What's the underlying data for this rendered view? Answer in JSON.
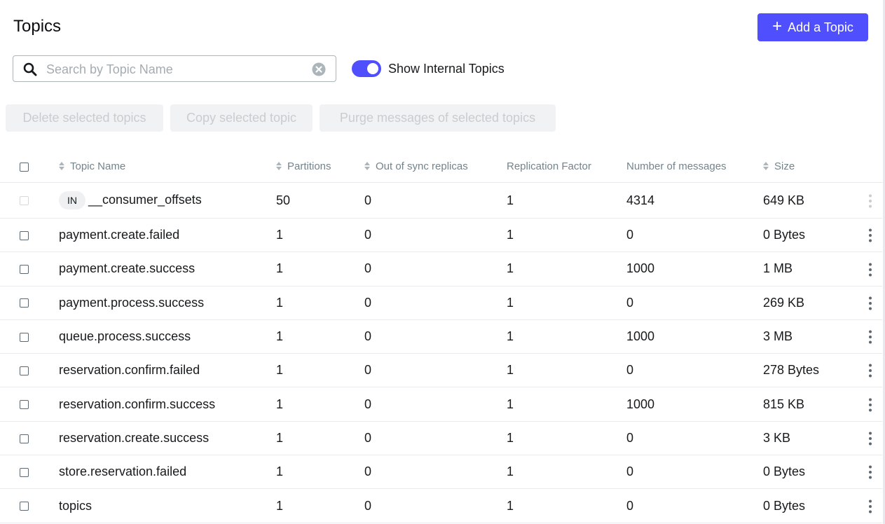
{
  "header": {
    "title": "Topics",
    "add_button_label": "Add a Topic"
  },
  "search": {
    "placeholder": "Search by Topic Name",
    "value": ""
  },
  "toggle": {
    "label": "Show Internal Topics",
    "checked": true
  },
  "actions": {
    "delete_label": "Delete selected topics",
    "copy_label": "Copy selected topic",
    "purge_label": "Purge messages of selected topics"
  },
  "table": {
    "columns": {
      "topic_name": "Topic Name",
      "partitions": "Partitions",
      "out_of_sync": "Out of sync replicas",
      "replication_factor": "Replication Factor",
      "messages": "Number of messages",
      "size": "Size"
    },
    "rows": [
      {
        "badge": "IN",
        "name": "__consumer_offsets",
        "partitions": "50",
        "out_of_sync": "0",
        "replication_factor": "1",
        "messages": "4314",
        "size": "649 KB"
      },
      {
        "badge": "",
        "name": "payment.create.failed",
        "partitions": "1",
        "out_of_sync": "0",
        "replication_factor": "1",
        "messages": "0",
        "size": "0 Bytes"
      },
      {
        "badge": "",
        "name": "payment.create.success",
        "partitions": "1",
        "out_of_sync": "0",
        "replication_factor": "1",
        "messages": "1000",
        "size": "1 MB"
      },
      {
        "badge": "",
        "name": "payment.process.success",
        "partitions": "1",
        "out_of_sync": "0",
        "replication_factor": "1",
        "messages": "0",
        "size": "269 KB"
      },
      {
        "badge": "",
        "name": "queue.process.success",
        "partitions": "1",
        "out_of_sync": "0",
        "replication_factor": "1",
        "messages": "1000",
        "size": "3 MB"
      },
      {
        "badge": "",
        "name": "reservation.confirm.failed",
        "partitions": "1",
        "out_of_sync": "0",
        "replication_factor": "1",
        "messages": "0",
        "size": "278 Bytes"
      },
      {
        "badge": "",
        "name": "reservation.confirm.success",
        "partitions": "1",
        "out_of_sync": "0",
        "replication_factor": "1",
        "messages": "1000",
        "size": "815 KB"
      },
      {
        "badge": "",
        "name": "reservation.create.success",
        "partitions": "1",
        "out_of_sync": "0",
        "replication_factor": "1",
        "messages": "0",
        "size": "3 KB"
      },
      {
        "badge": "",
        "name": "store.reservation.failed",
        "partitions": "1",
        "out_of_sync": "0",
        "replication_factor": "1",
        "messages": "0",
        "size": "0 Bytes"
      },
      {
        "badge": "",
        "name": "topics",
        "partitions": "1",
        "out_of_sync": "0",
        "replication_factor": "1",
        "messages": "0",
        "size": "0 Bytes"
      }
    ]
  },
  "icons": {
    "search": "search-icon",
    "clear": "clear-icon",
    "plus": "plus-icon",
    "sort": "sort-icon",
    "menu": "kebab-menu-icon"
  },
  "colors": {
    "accent": "#4f4ffe",
    "disabled_bg": "#f1f2f3",
    "disabled_text": "#c8cdd0",
    "header_text": "#73848c",
    "border": "#e8e9ec"
  }
}
